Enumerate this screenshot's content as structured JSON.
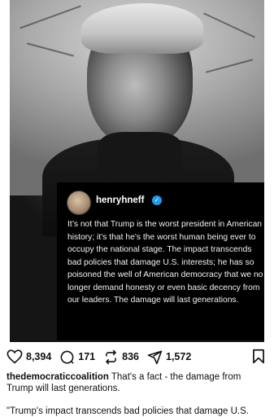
{
  "post": {
    "quote": {
      "handle": "henryhneff",
      "text": "It’s not that Trump is the worst president in American history; it’s that he’s the worst human being ever to occupy the national stage. The impact transcends bad policies that damage U.S. interests; he has so poisoned the well of American democracy that we no longer demand honesty or even basic decency from our leaders. The damage will last generations."
    },
    "actions": {
      "likes": "8,394",
      "comments": "171",
      "reposts": "836",
      "shares": "1,572"
    },
    "caption": {
      "username": "thedemocraticcoalition",
      "text": "That's a fact - the damage from Trump will last generations."
    },
    "comment_snippet": "\"Trump's impact transcends bad policies that damage U.S."
  },
  "colors": {
    "verified": "#1d9bf0",
    "card_background": "#000000"
  },
  "icons": [
    "heart-icon",
    "comment-icon",
    "repost-icon",
    "share-icon",
    "bookmark-icon",
    "verified-icon"
  ]
}
